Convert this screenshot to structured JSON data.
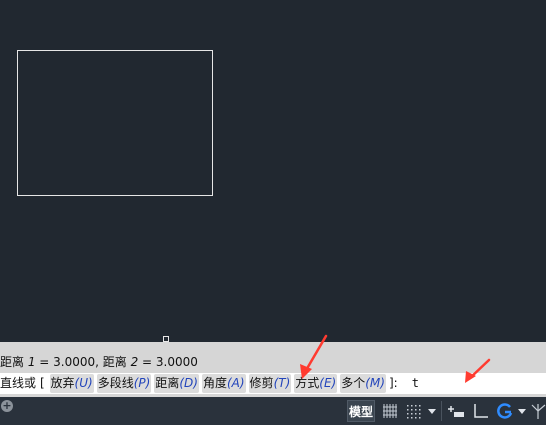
{
  "history": {
    "prefix": "距离 ",
    "dist1_label": "1",
    "mid1": " = 3.0000, 距离 ",
    "dist2_label": "2",
    "mid2": " = 3.0000"
  },
  "prompt": {
    "lead": "直线或",
    "open": "[",
    "options": [
      {
        "label": "放弃",
        "key": "(U)"
      },
      {
        "label": "多段线",
        "key": "(P)"
      },
      {
        "label": "距离",
        "key": "(D)"
      },
      {
        "label": "角度",
        "key": "(A)"
      },
      {
        "label": "修剪",
        "key": "(T)"
      },
      {
        "label": "方式",
        "key": "(E)"
      },
      {
        "label": "多个",
        "key": "(M)"
      }
    ],
    "close": "]:",
    "typed_value": "t"
  },
  "statusbar": {
    "model_label": "模型",
    "plus_glyph": "+"
  },
  "colors": {
    "canvas": "#212830",
    "command_bg": "#d6d6d6",
    "option_key": "#2244bb",
    "annotation_arrow": "#ff3b30"
  },
  "icons": [
    "grid-icon",
    "snap-icon",
    "dropdown-icon",
    "dynamic-input-icon",
    "ortho-icon",
    "polar-tracking-icon",
    "object-snap-tracking-icon"
  ]
}
